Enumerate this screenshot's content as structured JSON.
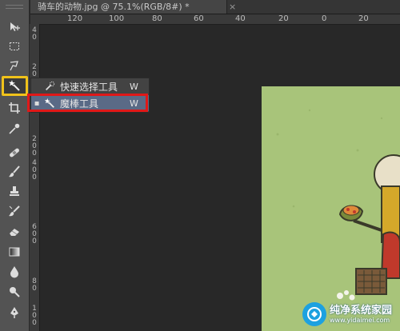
{
  "document": {
    "title": "骑车的动物.jpg @ 75.1%(RGB/8#) *",
    "close_glyph": "×"
  },
  "ruler": {
    "horizontal": [
      "120",
      "100",
      "80",
      "60",
      "40",
      "20",
      "0",
      "20"
    ],
    "vertical": [
      "4",
      "0",
      "2",
      "0",
      "0",
      "2",
      "0",
      "0",
      "4",
      "0",
      "0",
      "6",
      "0",
      "0",
      "8",
      "0",
      "1",
      "0",
      "0"
    ]
  },
  "tools": [
    {
      "name": "move-tool",
      "icon": "move-icon"
    },
    {
      "name": "marquee-tool",
      "icon": "marquee-icon"
    },
    {
      "name": "lasso-tool",
      "icon": "lasso-icon"
    },
    {
      "name": "magic-wand-tool",
      "icon": "magic-wand-icon",
      "selected": true
    },
    {
      "name": "crop-tool",
      "icon": "crop-icon"
    },
    {
      "name": "eyedropper-tool",
      "icon": "eyedropper-icon"
    },
    {
      "name": "healing-brush-tool",
      "icon": "bandage-icon"
    },
    {
      "name": "brush-tool",
      "icon": "brush-icon"
    },
    {
      "name": "clone-stamp-tool",
      "icon": "stamp-icon"
    },
    {
      "name": "history-brush-tool",
      "icon": "history-brush-icon"
    },
    {
      "name": "eraser-tool",
      "icon": "eraser-icon"
    },
    {
      "name": "gradient-tool",
      "icon": "gradient-icon"
    },
    {
      "name": "blur-tool",
      "icon": "drop-icon"
    },
    {
      "name": "dodge-tool",
      "icon": "dodge-icon"
    },
    {
      "name": "pen-tool",
      "icon": "pen-icon"
    }
  ],
  "flyout": {
    "items": [
      {
        "label": "快速选择工具",
        "shortcut": "W",
        "icon": "quick-selection-icon",
        "active": false
      },
      {
        "label": "魔棒工具",
        "shortcut": "W",
        "icon": "magic-wand-icon",
        "active": true,
        "bullet": "▪"
      }
    ]
  },
  "watermark": {
    "title": "纯净系统家园",
    "url": "www.yidaimei.com"
  },
  "colors": {
    "highlight_yellow": "#f0c21a",
    "highlight_red": "#e01818",
    "canvas_green": "#a8c47a",
    "active_item": "#5a6a86"
  }
}
